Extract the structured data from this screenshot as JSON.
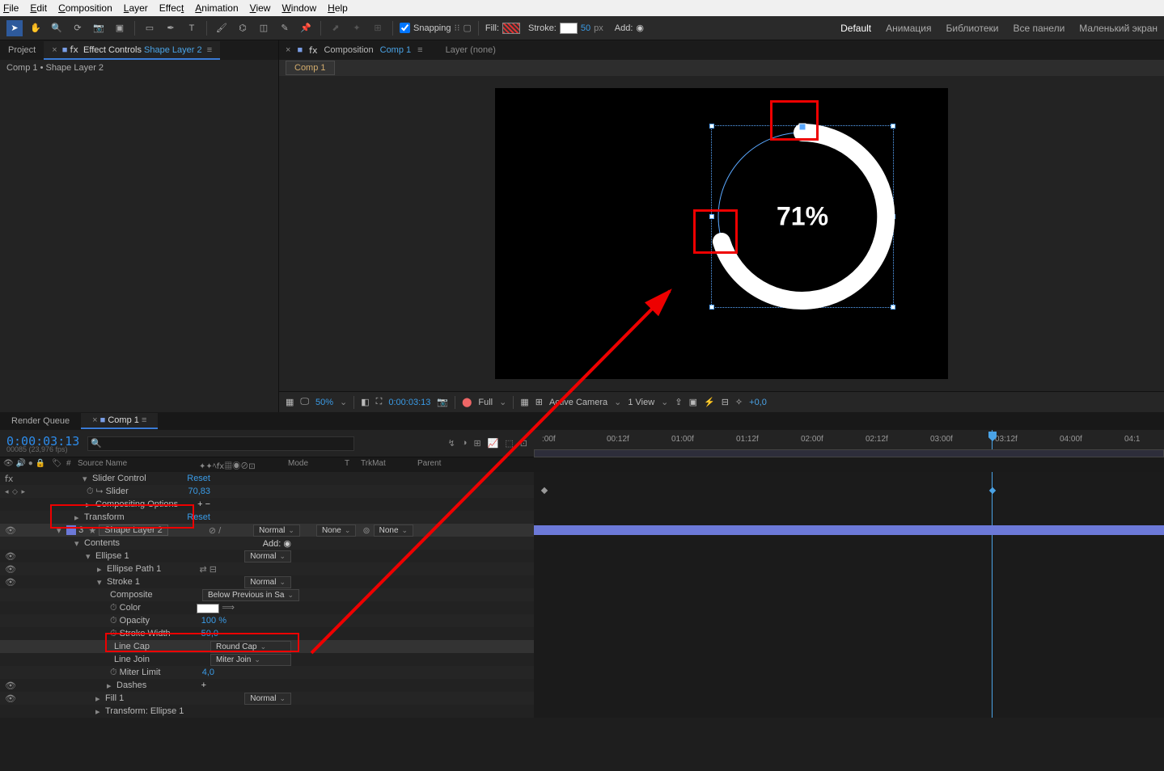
{
  "menu": {
    "file": "File",
    "edit": "Edit",
    "composition": "Composition",
    "layer": "Layer",
    "effect": "Effect",
    "animation": "Animation",
    "view": "View",
    "window": "Window",
    "help": "Help"
  },
  "toolbar": {
    "snapping": "Snapping",
    "fill": "Fill:",
    "stroke": "Stroke:",
    "stroke_val": "50",
    "stroke_unit": "px",
    "add": "Add:"
  },
  "workspaces": {
    "default": "Default",
    "anim": "Анимация",
    "libs": "Библиотеки",
    "all": "Все панели",
    "small": "Маленький экран"
  },
  "left": {
    "project": "Project",
    "effect_controls": "Effect Controls",
    "ec_target": "Shape Layer 2",
    "sub": "Comp 1 • Shape Layer 2"
  },
  "comp": {
    "label": "Composition",
    "name": "Comp 1",
    "layer_none": "Layer (none)",
    "crumb": "Comp 1",
    "percent": "71%"
  },
  "footer": {
    "zoom": "50%",
    "time": "0:00:03:13",
    "quality": "Full",
    "camera": "Active Camera",
    "views": "1 View",
    "offset": "+0,0"
  },
  "tl": {
    "render_queue": "Render Queue",
    "comp": "Comp 1",
    "timecode": "0:00:03:13",
    "frames": "00085 (23,976 fps)",
    "cols": {
      "source": "Source Name",
      "mode": "Mode",
      "t": "T",
      "trkmat": "TrkMat",
      "parent": "Parent"
    },
    "ticks": [
      ":00f",
      "00:12f",
      "01:00f",
      "01:12f",
      "02:00f",
      "02:12f",
      "03:00f",
      "03:12f",
      "04:00f",
      "04:1"
    ],
    "rows": {
      "slider_control": "Slider Control",
      "reset": "Reset",
      "slider": "Slider",
      "slider_val": "70,83",
      "comp_opts": "Compositing Options",
      "transform": "Transform",
      "layer_num": "3",
      "layer_name": "Shape Layer 2",
      "contents": "Contents",
      "add": "Add:",
      "ellipse1": "Ellipse 1",
      "normal": "Normal",
      "none": "None",
      "ellipse_path": "Ellipse Path 1",
      "stroke1": "Stroke 1",
      "composite": "Composite",
      "composite_val": "Below Previous in Sa",
      "color": "Color",
      "opacity": "Opacity",
      "opacity_val": "100 %",
      "stroke_width": "Stroke Width",
      "stroke_width_val": "50,0",
      "line_cap": "Line Cap",
      "line_cap_val": "Round Cap",
      "line_join": "Line Join",
      "line_join_val": "Miter Join",
      "miter_limit": "Miter Limit",
      "miter_limit_val": "4,0",
      "dashes": "Dashes",
      "fill1": "Fill 1",
      "transform_ellipse": "Transform: Ellipse 1"
    }
  }
}
